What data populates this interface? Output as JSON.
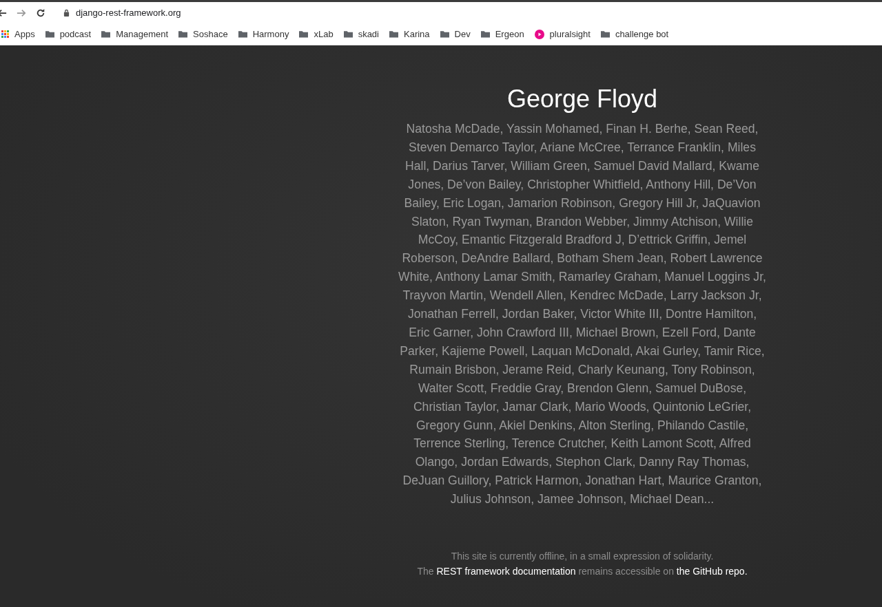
{
  "browser": {
    "url": "django-rest-framework.org",
    "bookmarks": [
      {
        "label": "Apps",
        "kind": "apps"
      },
      {
        "label": "podcast",
        "kind": "folder"
      },
      {
        "label": "Management",
        "kind": "folder"
      },
      {
        "label": "Soshace",
        "kind": "folder"
      },
      {
        "label": "Harmony",
        "kind": "folder"
      },
      {
        "label": "xLab",
        "kind": "folder"
      },
      {
        "label": "skadi",
        "kind": "folder"
      },
      {
        "label": "Karina",
        "kind": "folder"
      },
      {
        "label": "Dev",
        "kind": "folder"
      },
      {
        "label": "Ergeon",
        "kind": "folder"
      },
      {
        "label": "pluralsight",
        "kind": "site"
      },
      {
        "label": "challenge bot",
        "kind": "folder"
      }
    ]
  },
  "page": {
    "title": "George Floyd",
    "names": "Natosha McDade, Yassin Mohamed, Finan H. Berhe, Sean Reed, Steven Demarco Taylor, Ariane McCree, Terrance Franklin, Miles Hall, Darius Tarver, William Green, Samuel David Mallard, Kwame Jones, De’von Bailey, Christopher Whitfield, Anthony Hill, De’Von Bailey, Eric Logan, Jamarion Robinson, Gregory Hill Jr, JaQuavion Slaton, Ryan Twyman, Brandon Webber, Jimmy Atchison, Willie McCoy, Emantic Fitzgerald Bradford J, D’ettrick Griffin, Jemel Roberson, DeAndre Ballard, Botham Shem Jean, Robert Lawrence White, Anthony Lamar Smith, Ramarley Graham, Manuel Loggins Jr, Trayvon Martin, Wendell Allen, Kendrec McDade, Larry Jackson Jr, Jonathan Ferrell, Jordan Baker, Victor White III, Dontre Hamilton, Eric Garner, John Crawford III, Michael Brown, Ezell Ford, Dante Parker, Kajieme Powell, Laquan McDonald, Akai Gurley, Tamir Rice, Rumain Brisbon, Jerame Reid, Charly Keunang, Tony Robinson, Walter Scott, Freddie Gray, Brendon Glenn, Samuel DuBose, Christian Taylor, Jamar Clark, Mario Woods, Quintonio LeGrier, Gregory Gunn, Akiel Denkins, Alton Sterling, Philando Castile, Terrence Sterling, Terence Crutcher, Keith Lamont Scott, Alfred Olango, Jordan Edwards, Stephon Clark, Danny Ray Thomas, DeJuan Guillory, Patrick Harmon, Jonathan Hart, Maurice Granton, Julius Johnson, Jamee Johnson, Michael Dean...",
    "footer": {
      "notice": "This site is currently offline, in a small expression of solidarity.",
      "access": [
        {
          "kind": "text",
          "text": "The"
        },
        {
          "kind": "link",
          "text": "REST framework documentation"
        },
        {
          "kind": "text",
          "text": "remains accessible on"
        },
        {
          "kind": "link",
          "text": "the GitHub repo."
        }
      ]
    }
  }
}
